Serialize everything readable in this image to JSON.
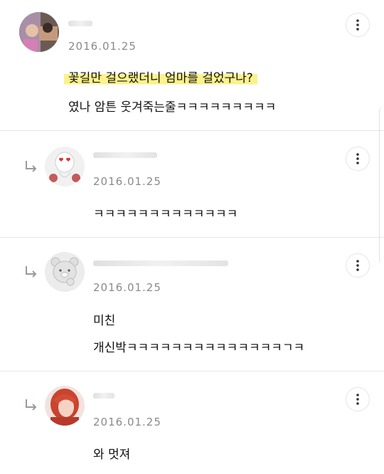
{
  "comments": [
    {
      "date": "2016.01.25",
      "lines": [
        "꽃길만 걸으랬더니 엄마를 걸었구나?",
        "였나 암튼 웃겨죽는줄ㅋㅋㅋㅋㅋㅋㅋㅋㅋ"
      ],
      "highlighted_first_line": true,
      "is_reply": false
    },
    {
      "date": "2016.01.25",
      "lines": [
        "ㅋㅋㅋㅋㅋㅋㅋㅋㅋㅋㅋㅋㅋ"
      ],
      "is_reply": true
    },
    {
      "date": "2016.01.25",
      "lines": [
        "미친",
        "개신박ㅋㅋㅋㅋㅋㅋㅋㅋㅋㅋㅋㅋㅋㅋㄱㅋ"
      ],
      "is_reply": true
    },
    {
      "date": "2016.01.25",
      "lines": [
        "와 멋져"
      ],
      "is_reply": true
    }
  ],
  "icons": {
    "more": "more-vertical-icon",
    "reply": "reply-arrow-icon"
  },
  "colors": {
    "highlight": "#fbf28c",
    "date": "#8a8a8a",
    "divider": "#e6e6e6"
  }
}
